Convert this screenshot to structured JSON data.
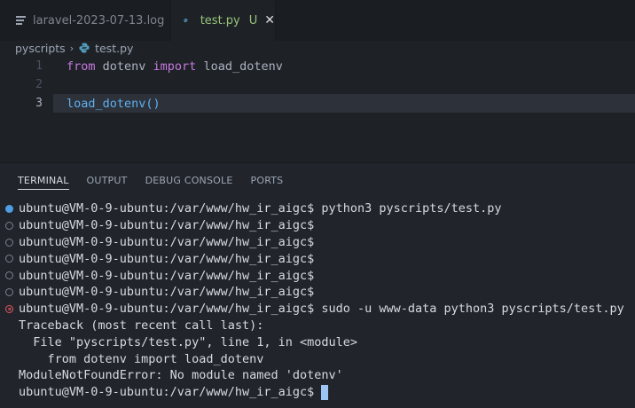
{
  "tabs": [
    {
      "label": "laravel-2023-07-13.log",
      "active": false
    },
    {
      "label": "test.py",
      "active": true,
      "status": "U",
      "close": "✕"
    }
  ],
  "breadcrumb": {
    "folder": "pyscripts",
    "file": "test.py"
  },
  "editor": {
    "lines": [
      {
        "num": "1",
        "kw1": "from",
        "mod": " dotenv ",
        "kw2": "import",
        "name": " load_dotenv"
      },
      {
        "num": "2"
      },
      {
        "num": "3",
        "fn": "load_dotenv",
        "parens": "()"
      }
    ]
  },
  "panel": {
    "tabs": [
      "TERMINAL",
      "OUTPUT",
      "DEBUG CONSOLE",
      "PORTS"
    ]
  },
  "terminal": {
    "lines": [
      {
        "text": "ubuntu@VM-0-9-ubuntu:/var/www/hw_ir_aigc$ python3 pyscripts/test.py",
        "deco": "success"
      },
      {
        "text": "ubuntu@VM-0-9-ubuntu:/var/www/hw_ir_aigc$",
        "deco": "circle"
      },
      {
        "text": "ubuntu@VM-0-9-ubuntu:/var/www/hw_ir_aigc$",
        "deco": "circle"
      },
      {
        "text": "ubuntu@VM-0-9-ubuntu:/var/www/hw_ir_aigc$",
        "deco": "circle"
      },
      {
        "text": "ubuntu@VM-0-9-ubuntu:/var/www/hw_ir_aigc$",
        "deco": "circle"
      },
      {
        "text": "ubuntu@VM-0-9-ubuntu:/var/www/hw_ir_aigc$",
        "deco": "circle"
      },
      {
        "text": "ubuntu@VM-0-9-ubuntu:/var/www/hw_ir_aigc$ sudo -u www-data python3 pyscripts/test.py",
        "deco": "error"
      },
      {
        "text": "Traceback (most recent call last):"
      },
      {
        "text": "  File \"pyscripts/test.py\", line 1, in <module>"
      },
      {
        "text": "    from dotenv import load_dotenv"
      },
      {
        "text": "ModuleNotFoundError: No module named 'dotenv'"
      },
      {
        "text": "ubuntu@VM-0-9-ubuntu:/var/www/hw_ir_aigc$"
      }
    ]
  },
  "colors": {
    "accent": "#4d9ee5",
    "error": "#e05561",
    "untracked": "#98c379"
  }
}
